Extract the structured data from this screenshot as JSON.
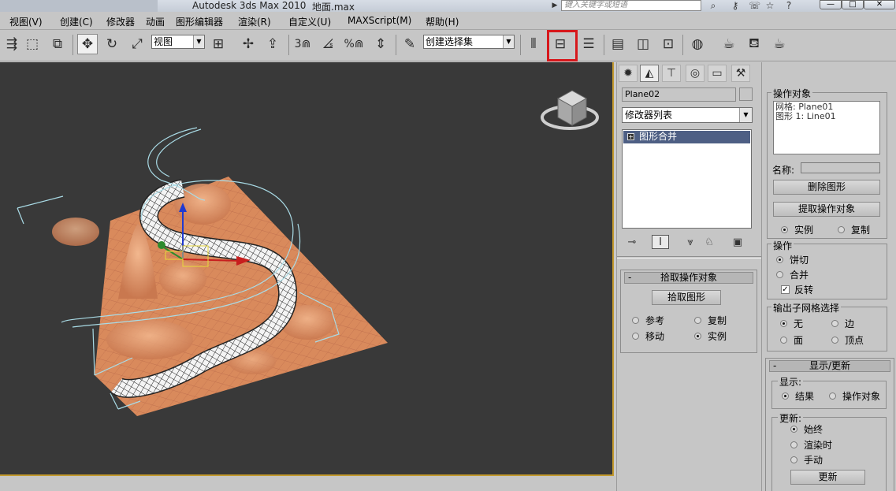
{
  "titlebar": {
    "app_title": "Autodesk 3ds Max  2010",
    "file_name": "地面.max",
    "search_placeholder": "键入关键字或短语",
    "window_buttons": [
      "—",
      "□",
      "✕"
    ]
  },
  "menu": [
    "视图(V)",
    "创建(C)",
    "修改器",
    "动画",
    "图形编辑器",
    "渲染(R)",
    "自定义(U)",
    "MAXScript(M)",
    "帮助(H)"
  ],
  "toolbar": {
    "view_dropdown": "视图",
    "selection_set_dropdown": "创建选择集",
    "snap_labels": [
      "3",
      "2.5",
      "%"
    ],
    "highlighted_tool": "align-icon"
  },
  "command_panel": {
    "tabs": [
      "create",
      "modify",
      "hierarchy",
      "motion",
      "display",
      "utilities"
    ],
    "object_name": "Plane02",
    "modifier_list": "修改器列表",
    "stack_items": [
      "图形合并"
    ],
    "pick_rollout": {
      "title": "拾取操作对象",
      "pick_button": "拾取图形",
      "options": [
        {
          "label": "参考",
          "checked": false
        },
        {
          "label": "复制",
          "checked": false
        },
        {
          "label": "移动",
          "checked": false
        },
        {
          "label": "实例",
          "checked": true
        }
      ]
    }
  },
  "right_panel": {
    "operands_title": "操作对象",
    "operands": [
      "网格: Plane01",
      "图形 1: Line01"
    ],
    "name_label": "名称:",
    "delete_button": "删除图形",
    "extract_button": "提取操作对象",
    "extract_options": [
      {
        "label": "实例",
        "checked": true
      },
      {
        "label": "复制",
        "checked": false
      }
    ],
    "operations_title": "操作",
    "operations": [
      {
        "label": "饼切",
        "checked": true
      },
      {
        "label": "合并",
        "checked": false
      }
    ],
    "invert_label": "反转",
    "invert_checked": true,
    "output_title": "输出子网格选择",
    "output_options": [
      {
        "label": "无",
        "checked": true
      },
      {
        "label": "边",
        "checked": false
      },
      {
        "label": "面",
        "checked": false
      },
      {
        "label": "顶点",
        "checked": false
      }
    ],
    "display_update_title": "显示/更新",
    "display_label": "显示:",
    "display_options": [
      {
        "label": "结果",
        "checked": true
      },
      {
        "label": "操作对象",
        "checked": false
      }
    ],
    "update_label": "更新:",
    "update_options": [
      {
        "label": "始终",
        "checked": true
      },
      {
        "label": "渲染时",
        "checked": false
      },
      {
        "label": "手动",
        "checked": false
      }
    ],
    "update_button": "更新"
  },
  "colors": {
    "viewport_bg": "#393939",
    "terrain": "#d98a5c",
    "spline": "#a9dbe6",
    "highlight": "#d7171b",
    "selection": "#4e5f84"
  }
}
